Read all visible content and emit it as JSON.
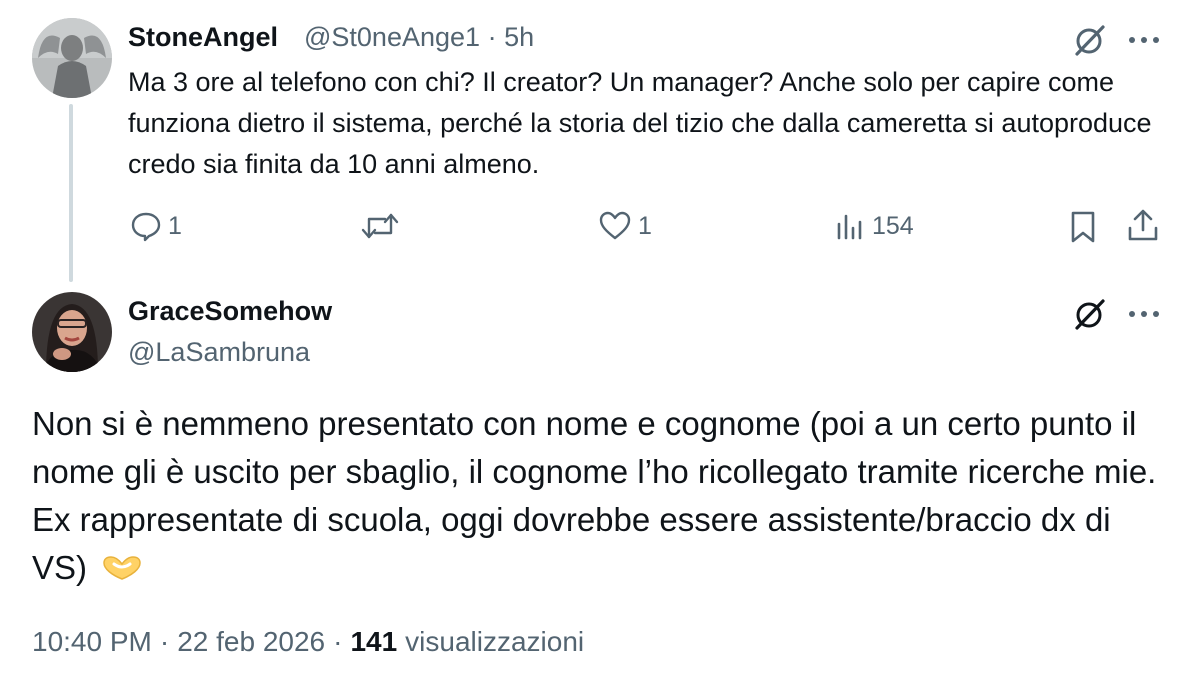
{
  "reply": {
    "author_name": "StoneAngel",
    "author_handle": "@St0neAnge1",
    "separator": "·",
    "time_ago": "5h",
    "text": "Ma 3 ore al telefono con chi? Il creator? Un manager? Anche solo per capire come funziona dietro il sistema, perché la storia del tizio che dalla cameretta si autoproduce credo sia finita da 10 anni almeno.",
    "actions": {
      "reply_count": "1",
      "retweet_count": "",
      "like_count": "1",
      "views_count": "154"
    },
    "icons": {
      "grok": "grok-icon",
      "more": "more-icon",
      "reply": "reply-icon",
      "retweet": "retweet-icon",
      "like": "heart-icon",
      "views": "views-icon",
      "bookmark": "bookmark-icon",
      "share": "share-icon"
    }
  },
  "main": {
    "author_name": "GraceSomehow",
    "author_handle": "@LaSambruna",
    "text": "Non si è nemmeno presentato con nome e cognome (poi a un certo punto il nome gli è uscito per sbaglio, il cognome l’ho ricollegato tramite ricerche mie. Ex rappresentate di scuola, oggi dovrebbe essere assistente/braccio dx di VS)",
    "emoji": "heart-hands-emoji",
    "time": "10:40 PM",
    "date": "22 feb 2026",
    "separator": "·",
    "views_count": "141",
    "views_label": "visualizzazioni"
  },
  "colors": {
    "text": "#0f1419",
    "secondary": "#536471",
    "thread_line": "#cfd9de",
    "emoji_yellow": "#ffd266"
  }
}
